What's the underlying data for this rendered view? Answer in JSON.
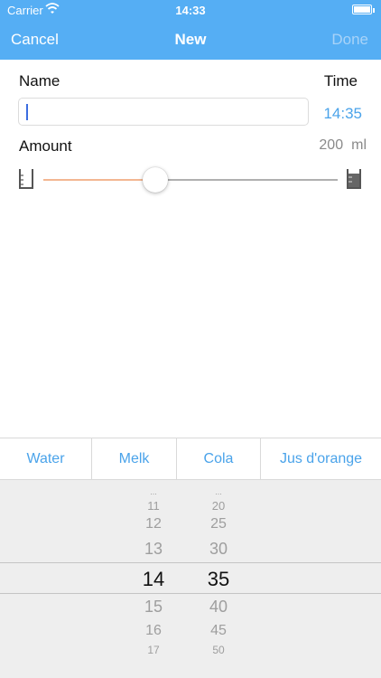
{
  "status_bar": {
    "carrier": "Carrier",
    "time": "14:33"
  },
  "nav": {
    "cancel": "Cancel",
    "title": "New",
    "done": "Done"
  },
  "form": {
    "name_label": "Name",
    "name_value": "",
    "time_label": "Time",
    "time_value": "14:35",
    "amount_label": "Amount",
    "amount_value": "200",
    "amount_unit": "ml",
    "slider_fraction": 0.38
  },
  "drinks": [
    "Water",
    "Melk",
    "Cola",
    "Jus d'orange"
  ],
  "picker": {
    "hours": [
      "...",
      "11",
      "12",
      "13",
      "14",
      "15",
      "16",
      "17"
    ],
    "minutes": [
      "...",
      "20",
      "25",
      "30",
      "35",
      "40",
      "45",
      "50"
    ],
    "selected_hour": "14",
    "selected_minute": "35"
  },
  "colors": {
    "nav_background": "#55aef4",
    "accent": "#4aa3ea",
    "slider_min_track": "#f3b792",
    "slider_max_track": "#b0b0b0",
    "picker_background": "#eeeeee"
  },
  "icons": {
    "wifi": "wifi-icon",
    "battery": "battery-icon",
    "beaker_empty": "beaker-empty-icon",
    "beaker_full": "beaker-full-icon"
  }
}
